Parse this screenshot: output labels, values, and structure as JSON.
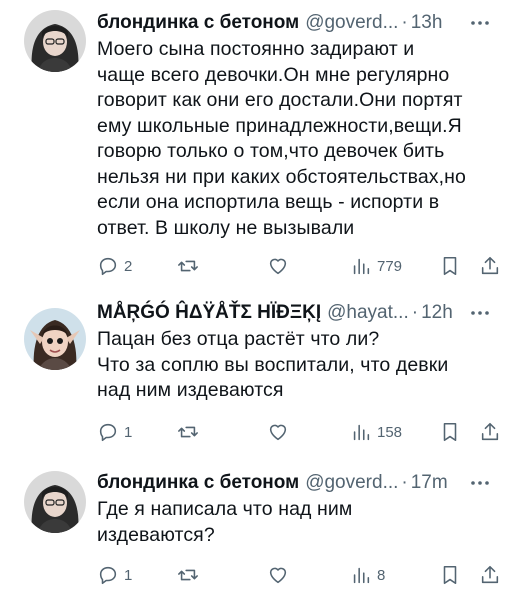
{
  "tweets": [
    {
      "name": "блондинка с бетоном",
      "handle": "@goverd...",
      "dot": "·",
      "time": "13h",
      "text": "Моего сына постоянно задирают и\nчаще всего девочки.Он мне регулярно\nговорит как они его достали.Они портят\nему школьные принадлежности,вещи.Я\nговорю только о том,что девочек бить\nнельзя ни при каких обстоятельствах,но\nесли она испортила вещь - испорти в\nответ. В школу не вызывали",
      "reply_count": "2",
      "views": "779"
    },
    {
      "name": "MÅŖǴÓ ĤΔŸÅŤΣ ΗÏĐΞĶĮ",
      "handle": "@hayat...",
      "dot": "·",
      "time": "12h",
      "text": "Пацан без отца растёт что ли?\nЧто за соплю вы воспитали, что девки\nнад ним издеваются",
      "reply_count": "1",
      "views": "158"
    },
    {
      "name": "блондинка с бетоном",
      "handle": "@goverd...",
      "dot": "·",
      "time": "17m",
      "text": "Где я написала что над ним\nиздеваются?",
      "reply_count": "1",
      "views": "8"
    }
  ],
  "icons": {
    "reply": "reply-icon",
    "retweet": "retweet-icon",
    "like": "heart-icon",
    "views": "views-icon",
    "bookmark": "bookmark-icon",
    "share": "share-icon",
    "more": "more-icon"
  },
  "colors": {
    "text": "#0f1419",
    "secondary": "#536471",
    "background": "#ffffff"
  }
}
